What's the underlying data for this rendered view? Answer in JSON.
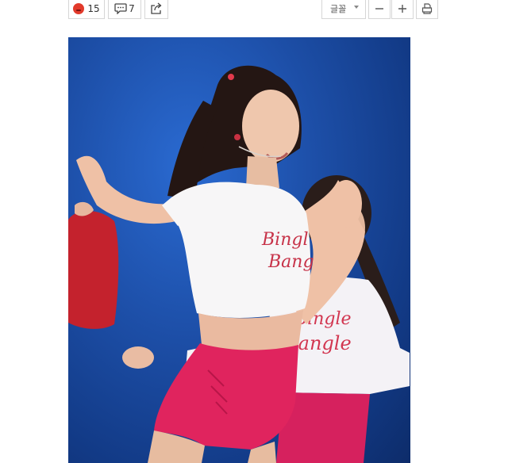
{
  "toolbar": {
    "reaction_count": "15",
    "comment_count": "7",
    "font_label": "글꼴"
  },
  "photo": {
    "shirt_text_front": "Bingle Bangle",
    "shirt_text_back": "Bingle Bangle"
  }
}
